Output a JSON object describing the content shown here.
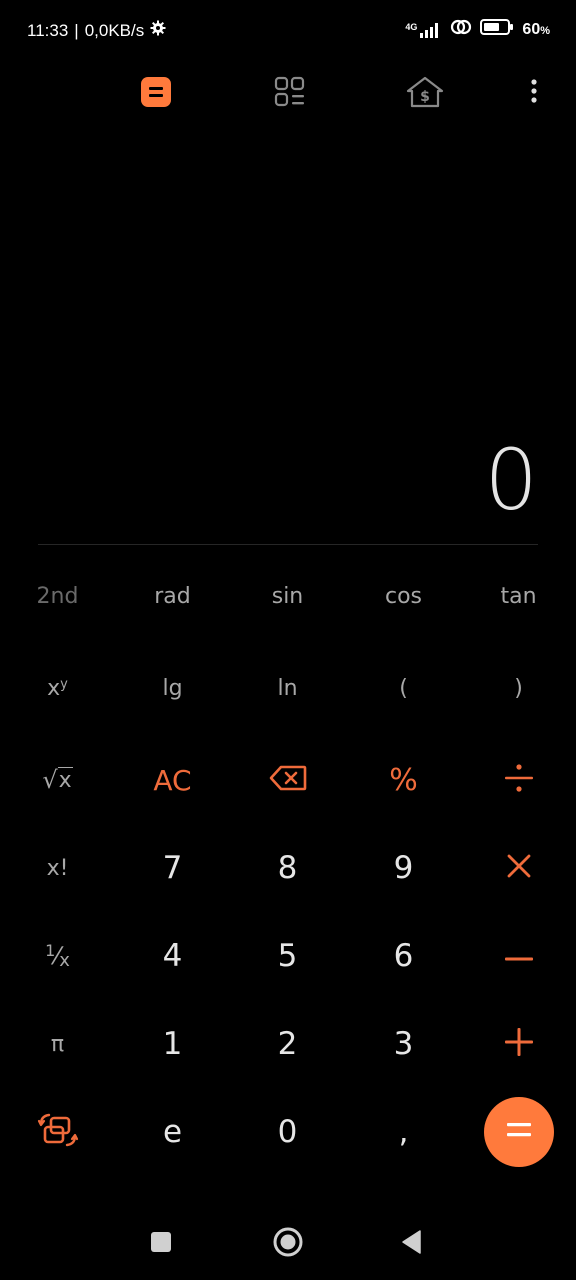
{
  "status_bar": {
    "time": "11:33",
    "separator": "|",
    "net_speed": "0,0KB/s",
    "network_type": "4G",
    "battery_value": "60",
    "battery_unit": "%",
    "icons": [
      "gear-icon",
      "signal-icon",
      "hotspot-link-icon",
      "battery-icon"
    ]
  },
  "toolbar": {
    "items": [
      {
        "name": "calculator",
        "icon": "calculator-icon",
        "active": true
      },
      {
        "name": "converter",
        "icon": "grid-list-icon",
        "active": false
      },
      {
        "name": "currency",
        "icon": "house-dollar-icon",
        "active": false
      },
      {
        "name": "more",
        "icon": "more-vertical-icon",
        "active": false
      }
    ]
  },
  "display": {
    "value": "0"
  },
  "keypad": {
    "rows": [
      [
        "2nd",
        "rad",
        "sin",
        "cos",
        "tan"
      ],
      [
        "x^y",
        "lg",
        "ln",
        "(",
        ")"
      ],
      [
        "√x",
        "AC",
        "backspace",
        "%",
        "÷"
      ],
      [
        "x!",
        "7",
        "8",
        "9",
        "×"
      ],
      [
        "1/x",
        "4",
        "5",
        "6",
        "−"
      ],
      [
        "π",
        "1",
        "2",
        "3",
        "+"
      ],
      [
        "swap",
        "e",
        "0",
        ",",
        "="
      ]
    ],
    "labels": {
      "second": "2nd",
      "rad": "rad",
      "sin": "sin",
      "cos": "cos",
      "tan": "tan",
      "pow_base": "x",
      "pow_exp": "y",
      "lg": "lg",
      "ln": "ln",
      "lparen": "(",
      "rparen": ")",
      "sqrt_sign": "√",
      "sqrt_x": "x",
      "ac": "AC",
      "percent": "%",
      "fact": "x!",
      "seven": "7",
      "eight": "8",
      "nine": "9",
      "inv_num": "1",
      "inv_slash": "⁄",
      "inv_x": "x",
      "four": "4",
      "five": "5",
      "six": "6",
      "pi": "π",
      "one": "1",
      "two": "2",
      "three": "3",
      "e": "e",
      "zero": "0",
      "comma": ","
    }
  },
  "colors": {
    "background": "#000000",
    "accent": "#ef6b3b",
    "equals_bg": "#ff7a3c",
    "digits": "#e6e6e6",
    "scientific": "#a8a8a8",
    "divider": "#262626"
  },
  "navbar": {
    "icons": [
      "recents-square-icon",
      "home-circle-icon",
      "back-triangle-icon"
    ]
  }
}
